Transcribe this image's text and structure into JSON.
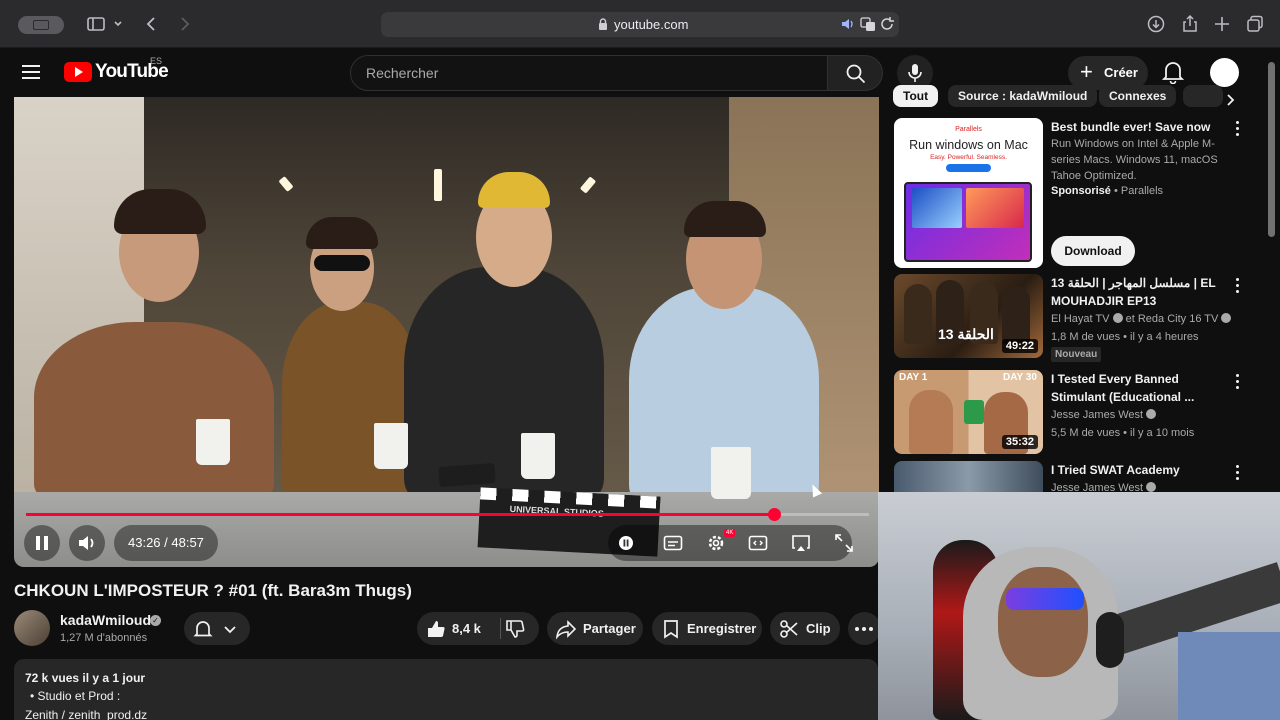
{
  "browser": {
    "url": "youtube.com"
  },
  "header": {
    "logo_text": "YouTube",
    "country_code": "ES",
    "search_placeholder": "Rechercher",
    "create_label": "Créer"
  },
  "player": {
    "time": "43:26 / 48:57",
    "progress_fraction": 0.8875,
    "clapperboard_text": "UNIVERSAL STUDIOS",
    "quality_badge": "4K"
  },
  "video": {
    "title": "CHKOUN L'IMPOSTEUR ? #01 (ft. Bara3m Thugs)",
    "channel": "kadaWmiloud",
    "subscribers": "1,27 M d'abonnés",
    "likes": "8,4 k",
    "share_label": "Partager",
    "save_label": "Enregistrer",
    "clip_label": "Clip"
  },
  "description": {
    "stats": "72 k vues  il y a 1 jour",
    "line2": "Studio et Prod :",
    "line3": "Zenith  / zenith_prod.dz"
  },
  "chips": [
    "Tout",
    "Source : kadaWmiloud",
    "Connexes"
  ],
  "sidebar": [
    {
      "title": "Best bundle ever! Save now",
      "desc": "Run Windows on Intel & Apple M-series Macs. Windows 11, macOS Tahoe Optimized.",
      "sponsor_label": "Sponsorisé",
      "sponsor": "Parallels",
      "cta": "Download",
      "thumb_title": "Run windows on Mac",
      "thumb_sub": "Easy. Powerful. Seamless.",
      "thumb_brand": "Parallels"
    },
    {
      "title": "مسلسل المهاجر | الحلقة 13 | EL MOUHADJIR EP13",
      "channel": "El Hayat TV",
      "channel2": "et Reda City 16 TV",
      "meta": "1,8 M de vues • il y a 4 heures",
      "badge": "Nouveau",
      "duration": "49:22",
      "thumb_text": "الحلقة 13"
    },
    {
      "title": "I Tested Every Banned Stimulant (Educational ...",
      "channel": "Jesse James West",
      "meta": "5,5 M de vues • il y a 10 mois",
      "duration": "35:32",
      "thumb_left": "DAY 1",
      "thumb_right": "DAY 30"
    },
    {
      "title": "I Tried SWAT Academy",
      "channel": "Jesse James West"
    }
  ],
  "colors": {
    "accent": "#ff0033",
    "background": "#0f0f0f"
  }
}
